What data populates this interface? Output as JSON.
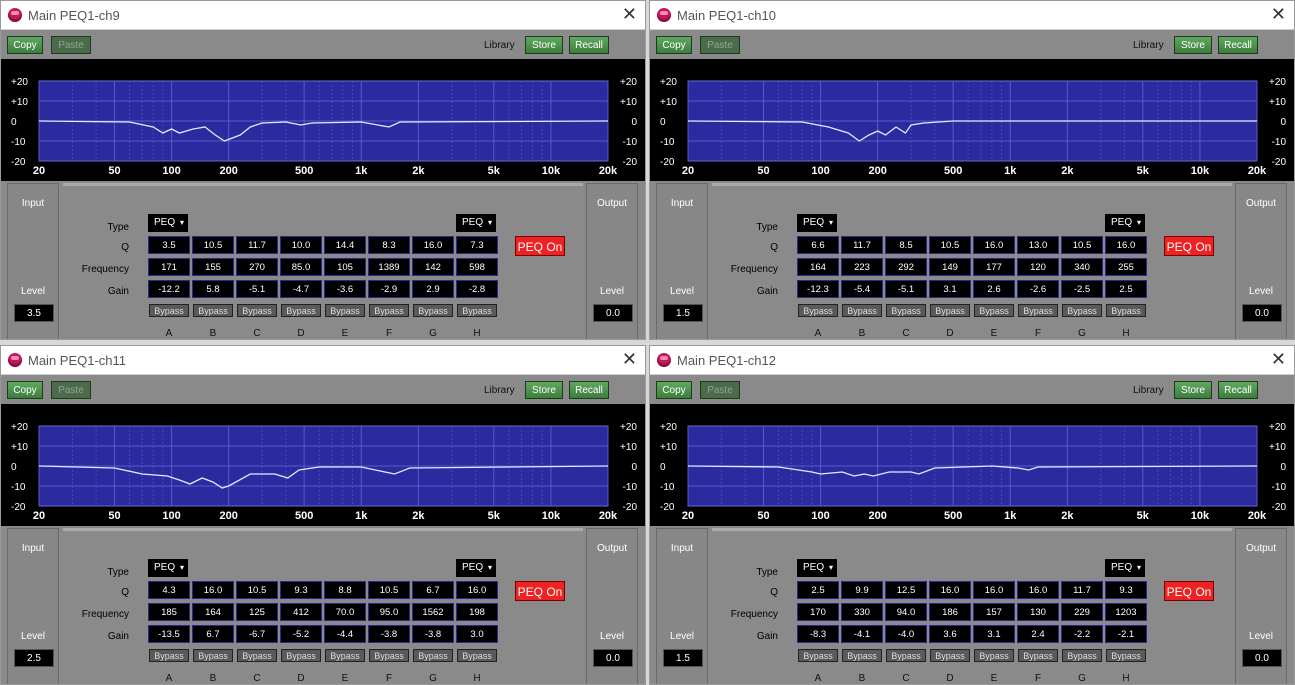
{
  "toolbar": {
    "copy": "Copy",
    "paste": "Paste",
    "library": "Library",
    "store": "Store",
    "recall": "Recall"
  },
  "graph": {
    "y_ticks": [
      "+20",
      "+10",
      "0",
      "-10",
      "-20"
    ],
    "x_ticks": [
      "20",
      "50",
      "100",
      "200",
      "500",
      "1k",
      "2k",
      "5k",
      "10k",
      "20k"
    ]
  },
  "labels": {
    "input": "Input",
    "output": "Output",
    "level": "Level",
    "type": "Type",
    "q": "Q",
    "frequency": "Frequency",
    "gain": "Gain",
    "bypass": "Bypass",
    "peq_on": "PEQ On"
  },
  "bands": [
    "A",
    "B",
    "C",
    "D",
    "E",
    "F",
    "G",
    "H"
  ],
  "windows": [
    {
      "title": "Main PEQ1-ch9",
      "input_level": "3.5",
      "output_level": "0.0",
      "type_a": "PEQ",
      "type_h": "PEQ",
      "q": [
        "3.5",
        "10.5",
        "11.7",
        "10.0",
        "14.4",
        "8.3",
        "16.0",
        "7.3"
      ],
      "freq": [
        "171",
        "155",
        "270",
        "85.0",
        "105",
        "1389",
        "142",
        "598"
      ],
      "gain": [
        "-12.2",
        "5.8",
        "-5.1",
        "-4.7",
        "-3.6",
        "-2.9",
        "2.9",
        "-2.8"
      ],
      "curve": [
        [
          20,
          0
        ],
        [
          60,
          -0.5
        ],
        [
          80,
          -3
        ],
        [
          90,
          -6
        ],
        [
          100,
          -4
        ],
        [
          110,
          -6
        ],
        [
          130,
          -4
        ],
        [
          150,
          -3
        ],
        [
          170,
          -7
        ],
        [
          190,
          -10
        ],
        [
          230,
          -7
        ],
        [
          260,
          -3
        ],
        [
          300,
          -1
        ],
        [
          400,
          -0.5
        ],
        [
          480,
          -2
        ],
        [
          550,
          -1
        ],
        [
          1000,
          -0.5
        ],
        [
          1400,
          -3
        ],
        [
          1600,
          -0.5
        ],
        [
          20000,
          0
        ]
      ]
    },
    {
      "title": "Main PEQ1-ch10",
      "input_level": "1.5",
      "output_level": "0.0",
      "type_a": "PEQ",
      "type_h": "PEQ",
      "q": [
        "6.6",
        "11.7",
        "8.5",
        "10.5",
        "16.0",
        "13.0",
        "10.5",
        "16.0"
      ],
      "freq": [
        "164",
        "223",
        "292",
        "149",
        "177",
        "120",
        "340",
        "255"
      ],
      "gain": [
        "-12.3",
        "-5.4",
        "-5.1",
        "3.1",
        "2.6",
        "-2.6",
        "-2.5",
        "2.5"
      ],
      "curve": [
        [
          20,
          0
        ],
        [
          80,
          -0.5
        ],
        [
          110,
          -3
        ],
        [
          140,
          -6
        ],
        [
          160,
          -10
        ],
        [
          180,
          -7
        ],
        [
          200,
          -5
        ],
        [
          220,
          -7
        ],
        [
          250,
          -3
        ],
        [
          280,
          -6
        ],
        [
          300,
          -2
        ],
        [
          350,
          -1
        ],
        [
          500,
          0
        ],
        [
          20000,
          0
        ]
      ]
    },
    {
      "title": "Main PEQ1-ch11",
      "input_level": "2.5",
      "output_level": "0.0",
      "type_a": "PEQ",
      "type_h": "PEQ",
      "q": [
        "4.3",
        "16.0",
        "10.5",
        "9.3",
        "8.8",
        "10.5",
        "6.7",
        "16.0"
      ],
      "freq": [
        "185",
        "164",
        "125",
        "412",
        "70.0",
        "95.0",
        "1562",
        "198"
      ],
      "gain": [
        "-13.5",
        "6.7",
        "-6.7",
        "-5.2",
        "-4.4",
        "-3.8",
        "-3.8",
        "3.0"
      ],
      "curve": [
        [
          20,
          0
        ],
        [
          50,
          -1
        ],
        [
          70,
          -4
        ],
        [
          95,
          -5
        ],
        [
          110,
          -7
        ],
        [
          125,
          -9
        ],
        [
          145,
          -6
        ],
        [
          165,
          -8
        ],
        [
          185,
          -11
        ],
        [
          200,
          -10
        ],
        [
          260,
          -4
        ],
        [
          350,
          -4
        ],
        [
          410,
          -6
        ],
        [
          470,
          -2
        ],
        [
          600,
          -0.5
        ],
        [
          1000,
          -0.5
        ],
        [
          1500,
          -4
        ],
        [
          1800,
          -1
        ],
        [
          20000,
          0
        ]
      ]
    },
    {
      "title": "Main PEQ1-ch12",
      "input_level": "1.5",
      "output_level": "0.0",
      "type_a": "PEQ",
      "type_h": "PEQ",
      "q": [
        "2.5",
        "9.9",
        "12.5",
        "16.0",
        "16.0",
        "16.0",
        "11.7",
        "9.3"
      ],
      "freq": [
        "170",
        "330",
        "94.0",
        "186",
        "157",
        "130",
        "229",
        "1203"
      ],
      "gain": [
        "-8.3",
        "-4.1",
        "-4.0",
        "3.6",
        "3.1",
        "2.4",
        "-2.2",
        "-2.1"
      ],
      "curve": [
        [
          20,
          0
        ],
        [
          60,
          -0.5
        ],
        [
          90,
          -3
        ],
        [
          100,
          -4
        ],
        [
          130,
          -3
        ],
        [
          150,
          -5
        ],
        [
          170,
          -4
        ],
        [
          190,
          -5
        ],
        [
          230,
          -3
        ],
        [
          300,
          -3
        ],
        [
          330,
          -4
        ],
        [
          400,
          -1
        ],
        [
          800,
          0
        ],
        [
          1100,
          -1
        ],
        [
          1250,
          -2
        ],
        [
          1400,
          -0.5
        ],
        [
          20000,
          0
        ]
      ]
    }
  ]
}
